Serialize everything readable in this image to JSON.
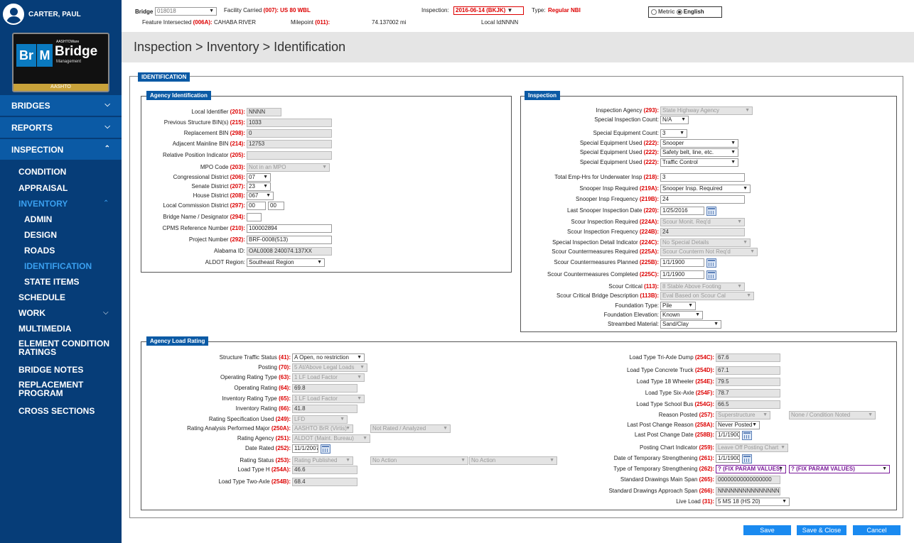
{
  "user": {
    "name": "CARTER, PAUL"
  },
  "logo": {
    "small": "AASHTOWare",
    "br": "Br",
    "m": "M",
    "bridge": "Bridge",
    "management": "Management",
    "org": "AASHTO"
  },
  "nav": {
    "main": [
      {
        "label": "BRIDGES"
      },
      {
        "label": "REPORTS"
      },
      {
        "label": "INSPECTION"
      }
    ],
    "inspection_sub": [
      {
        "label": "CONDITION"
      },
      {
        "label": "APPRAISAL"
      },
      {
        "label": "INVENTORY"
      }
    ],
    "inventory_sub": [
      {
        "label": "ADMIN"
      },
      {
        "label": "DESIGN"
      },
      {
        "label": "ROADS"
      },
      {
        "label": "IDENTIFICATION"
      },
      {
        "label": "STATE ITEMS"
      }
    ],
    "more": [
      {
        "label": "SCHEDULE"
      },
      {
        "label": "WORK"
      },
      {
        "label": "MULTIMEDIA"
      },
      {
        "label": "ELEMENT CONDITION RATINGS"
      },
      {
        "label": "BRIDGE NOTES"
      },
      {
        "label": "REPLACEMENT PROGRAM"
      },
      {
        "label": "CROSS SECTIONS"
      }
    ]
  },
  "header": {
    "bridge_label": "Bridge",
    "bridge_value": "018018",
    "facility_label": "Facility Carried ",
    "facility_code": "(007):",
    "facility_value": "US 80 WBL",
    "feature_label": "Feature Intersected ",
    "feature_code": "(006A):",
    "feature_value": "CAHABA RIVER",
    "milepoint_label": "Milepoint ",
    "milepoint_code": "(011):",
    "milepoint_value": "74.137002 mi",
    "inspection_label": "Inspection:",
    "inspection_value": "2016-06-14 (BKJK)",
    "type_label": "Type:",
    "type_value": "Regular NBI",
    "localid_label": "Local Id:",
    "localid_value": "NNNN",
    "metric": "Metric",
    "english": "English"
  },
  "breadcrumb": "Inspection > Inventory > Identification",
  "section_title": "IDENTIFICATION",
  "agency_id": {
    "title": "Agency Identification",
    "fields": [
      {
        "label": "Local Identifier ",
        "code": "(201):",
        "value": "NNNN"
      },
      {
        "label": "Previous Structure BIN(s) ",
        "code": "(215):",
        "value": "1033"
      },
      {
        "label": "Replacement BIN ",
        "code": "(298):",
        "value": "0"
      },
      {
        "label": "Adjacent Mainline BIN ",
        "code": "(214):",
        "value": "12753"
      },
      {
        "label": "Relative Position Indicator ",
        "code": "(205):",
        "value": ""
      },
      {
        "label": "MPO Code ",
        "code": "(203):",
        "value": "Not in an MPO"
      },
      {
        "label": "Congressional District ",
        "code": "(206):",
        "value": "07"
      },
      {
        "label": "Senate District ",
        "code": "(207):",
        "value": "23"
      },
      {
        "label": "House District ",
        "code": "(208):",
        "value": "067"
      },
      {
        "label": "Local Commission District ",
        "code": "(297):",
        "value": "00",
        "value2": "00"
      },
      {
        "label": "Bridge Name / Designator ",
        "code": "(294):",
        "value": ""
      },
      {
        "label": "CPMS Reference Number ",
        "code": "(210):",
        "value": "100002894"
      },
      {
        "label": "Project Number ",
        "code": "(292):",
        "value": "BRF-0008(513)"
      },
      {
        "label": "Alabama ID:",
        "code": "",
        "value": "OAL0008 240074.137XX"
      },
      {
        "label": "ALDOT Region:",
        "code": "",
        "value": "Southeast Region"
      }
    ]
  },
  "inspection": {
    "title": "Inspection",
    "fields": [
      {
        "label": "Inspection Agency ",
        "code": "(293):",
        "value": "State Highway Agency"
      },
      {
        "label": "Special Inspection Count:",
        "code": "",
        "value": "N/A"
      },
      {
        "label": "Special Equipment Count:",
        "code": "",
        "value": "3"
      },
      {
        "label": "Special Equipment Used ",
        "code": "(222):",
        "value": "Snooper"
      },
      {
        "label": "Special Equipment Used ",
        "code": "(222):",
        "value": "Safety belt, line, etc."
      },
      {
        "label": "Special Equipment Used ",
        "code": "(222):",
        "value": "Traffic Control"
      },
      {
        "label": "Total Emp-Hrs for Underwater Insp ",
        "code": "(218):",
        "value": "3"
      },
      {
        "label": "Snooper Insp Required ",
        "code": "(219A):",
        "value": "Snooper Insp. Required"
      },
      {
        "label": "Snooper Insp Frequency ",
        "code": "(219B):",
        "value": "24"
      },
      {
        "label": "Last Snooper Inspection Date ",
        "code": "(220):",
        "value": "1/25/2016"
      },
      {
        "label": "Scour Inspection Required ",
        "code": "(224A):",
        "value": "Scour Monit. Req'd"
      },
      {
        "label": "Scour Inspection Frequency ",
        "code": "(224B):",
        "value": "24"
      },
      {
        "label": "Special Inspection Detail Indicator ",
        "code": "(224C):",
        "value": "No Special Details"
      },
      {
        "label": "Scour Countermeasures Required ",
        "code": "(225A):",
        "value": "Scour Counterm Not Req'd"
      },
      {
        "label": "Scour Countermeasures Planned ",
        "code": "(225B):",
        "value": "1/1/1900"
      },
      {
        "label": "Scour Countermeasures Completed ",
        "code": "(225C):",
        "value": "1/1/1900"
      },
      {
        "label": "Scour Critical ",
        "code": "(113):",
        "value": "8 Stable Above Footing"
      },
      {
        "label": "Scour Critical Bridge Description ",
        "code": "(113B):",
        "value": "Eval Based on Scour Cal"
      },
      {
        "label": "Foundation Type:",
        "code": "",
        "value": "Pile"
      },
      {
        "label": "Foundation Elevation:",
        "code": "",
        "value": "Known"
      },
      {
        "label": "Streambed Material:",
        "code": "",
        "value": "Sand/Clay"
      }
    ]
  },
  "load_rating": {
    "title": "Agency Load Rating",
    "left": [
      {
        "label": "Structure Traffic Status ",
        "code": "(41):",
        "value": "A Open, no restriction"
      },
      {
        "label": "Posting ",
        "code": "(70):",
        "value": "5 At/Above Legal Loads"
      },
      {
        "label": "Operating Rating Type ",
        "code": "(63):",
        "value": "1 LF Load Factor"
      },
      {
        "label": "Operating Rating ",
        "code": "(64):",
        "value": "69.8"
      },
      {
        "label": "Inventory Rating Type ",
        "code": "(65):",
        "value": "1 LF Load Factor"
      },
      {
        "label": "Inventory Rating ",
        "code": "(66):",
        "value": "41.8"
      },
      {
        "label": "Rating Specification Used ",
        "code": "(249):",
        "value": "LFD"
      },
      {
        "label": "Rating Analysis Performed Major ",
        "code": "(250A):",
        "value": "AASHTO BrR (Virtis)",
        "value2": "Not Rated / Analyzed"
      },
      {
        "label": "Rating Agency ",
        "code": "(251):",
        "value": "ALDOT (Maint. Bureau)"
      },
      {
        "label": "Date Rated ",
        "code": "(252):",
        "value": "11/1/2007"
      },
      {
        "label": "Rating Status ",
        "code": "(253):",
        "value": "Rating Published",
        "value2": "No Action",
        "value3": "No Action"
      },
      {
        "label": "Load Type H ",
        "code": "(254A):",
        "value": "46.6"
      },
      {
        "label": "Load Type Two-Axle ",
        "code": "(254B):",
        "value": "68.4"
      }
    ],
    "right": [
      {
        "label": "Load Type Tri-Axle Dump ",
        "code": "(254C):",
        "value": "67.6"
      },
      {
        "label": "Load Type Concrete Truck ",
        "code": "(254D):",
        "value": "67.1"
      },
      {
        "label": "Load Type 18 Wheeler ",
        "code": "(254E):",
        "value": "79.5"
      },
      {
        "label": "Load Type Six-Axle ",
        "code": "(254F):",
        "value": "78.7"
      },
      {
        "label": "Load Type School Bus ",
        "code": "(254G):",
        "value": "66.5"
      },
      {
        "label": "Reason Posted ",
        "code": "(257):",
        "value": "Superstructure",
        "value2": "None / Condition Noted"
      },
      {
        "label": "Last Post Change Reason ",
        "code": "(258A):",
        "value": "Never Posted"
      },
      {
        "label": "Last Post Change Date ",
        "code": "(258B):",
        "value": "1/1/1900"
      },
      {
        "label": "Posting Chart Indicator ",
        "code": "(259):",
        "value": "Leave Off Posting Chart"
      },
      {
        "label": "Date of Temporary Strengthening ",
        "code": "(261):",
        "value": "1/1/1900"
      },
      {
        "label": "Type of Temporary Strengthening ",
        "code": "(262):",
        "value": "? (FIX PARAM VALUES)",
        "value2": "? (FIX PARAM VALUES)"
      },
      {
        "label": "Standard Drawings Main Span ",
        "code": "(265):",
        "value": "00000000000000000"
      },
      {
        "label": "Standard Drawings Approach Span ",
        "code": "(266):",
        "value": "NNNNNNNNNNNNNNNNN"
      },
      {
        "label": "Live Load ",
        "code": "(31):",
        "value": "5 MS 18 (HS 20)"
      }
    ]
  },
  "buttons": {
    "save": "Save",
    "save_close": "Save & Close",
    "cancel": "Cancel"
  }
}
